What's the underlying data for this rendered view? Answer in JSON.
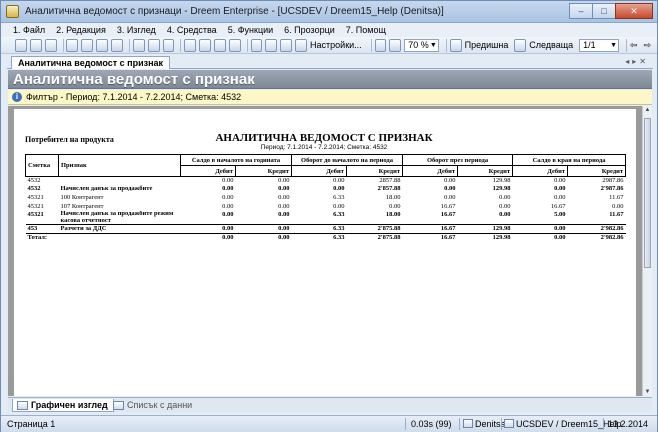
{
  "window": {
    "title": "Аналитична ведомост с признаци - Dreem Enterprise - [UCSDEV / Dreem15_Help (Denitsa)]",
    "controls": {
      "minimize": "–",
      "maximize": "□",
      "close": "✕"
    }
  },
  "menu": [
    "1. Файл",
    "2. Редакция",
    "3. Изглед",
    "4. Средства",
    "5. Функции",
    "6. Прозорци",
    "7. Помощ"
  ],
  "toolbar": {
    "settings_label": "Настройки...",
    "zoom_value": "70 %",
    "prev_label": "Предишна",
    "next_label": "Следваща",
    "page_value": "1/1"
  },
  "tab": {
    "label": "Аналитична ведомост с признак"
  },
  "header": {
    "title": "Аналитична ведомост с признак",
    "filter": "Филтър - Период: 7.1.2014 - 7.2.2014; Сметка: 4532"
  },
  "report": {
    "consumer": "Потребител на продукта",
    "title": "АНАЛИТИЧНА ВЕДОМОСТ С ПРИЗНАК",
    "subtitle": "Период: 7.1.2014 - 7.2.2014; Сметка: 4532",
    "columns": {
      "account": "Сметка",
      "feature": "Признак",
      "group_start": "Салдо в началото на годината",
      "group_turnover_start": "Оборот до началото на периода",
      "group_turnover_period": "Оборот през периода",
      "group_end": "Салдо в края на периода",
      "debit": "Дебит",
      "credit": "Кредит"
    },
    "rows": [
      {
        "account": "4532",
        "feature": "",
        "v": [
          "0.00",
          "0.00",
          "0.00",
          "2857.88",
          "0.00",
          "129.98",
          "0.00",
          "2987.86"
        ],
        "bold": false
      },
      {
        "account": "4532",
        "feature": "Начислен данък за продажбите",
        "v": [
          "0.00",
          "0.00",
          "0.00",
          "2'857.88",
          "0.00",
          "129.98",
          "0.00",
          "2'987.86"
        ],
        "bold": true
      },
      {
        "account": "45321",
        "feature": "100 Контрагент",
        "v": [
          "0.00",
          "0.00",
          "6.33",
          "18.00",
          "0.00",
          "0.00",
          "0.00",
          "11.67"
        ],
        "bold": false
      },
      {
        "account": "45321",
        "feature": "107 Контрагент",
        "v": [
          "0.00",
          "0.00",
          "0.00",
          "0.00",
          "16.67",
          "0.00",
          "16.67",
          "0.00"
        ],
        "bold": false
      },
      {
        "account": "45321",
        "feature": "Начислен данък за продажбите режим касова отчетност",
        "v": [
          "0.00",
          "0.00",
          "6.33",
          "18.00",
          "16.67",
          "0.00",
          "5.00",
          "11.67"
        ],
        "bold": true
      }
    ],
    "total_453": {
      "account": "453",
      "feature": "Разчети за ДДС",
      "v": [
        "0.00",
        "0.00",
        "6.33",
        "2'875.88",
        "16.67",
        "129.98",
        "0.00",
        "2'982.86"
      ]
    },
    "total": {
      "label": "Тотал:",
      "v": [
        "0.00",
        "0.00",
        "6.33",
        "2'875.88",
        "16.67",
        "129.98",
        "0.00",
        "2'982.86"
      ]
    }
  },
  "viewtabs": {
    "graphic": "Графичен изглед",
    "list": "Списък с данни"
  },
  "status": {
    "page": "Страница 1",
    "time": "0.03s (99)",
    "user": "Denitsa",
    "db": "UCSDEV / Dreem15_Help",
    "date": "13.2.2014"
  }
}
